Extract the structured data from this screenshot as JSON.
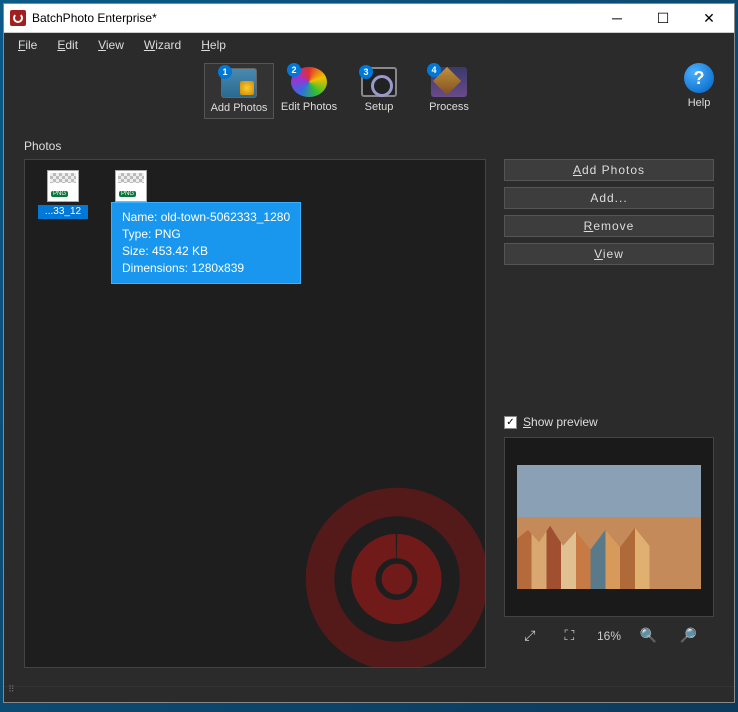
{
  "window": {
    "title": "BatchPhoto Enterprise*"
  },
  "menu": {
    "file": "File",
    "edit": "Edit",
    "view": "View",
    "wizard": "Wizard",
    "help": "Help"
  },
  "toolbar": {
    "add_photos": "Add Photos",
    "edit_photos": "Edit Photos",
    "setup": "Setup",
    "process": "Process",
    "help": "Help",
    "badges": {
      "add": "1",
      "edit": "2",
      "setup": "3",
      "process": "4"
    }
  },
  "section": {
    "photos": "Photos"
  },
  "thumbs": {
    "t0_label": "...33_12"
  },
  "tooltip": {
    "name_label": "Name: ",
    "name_value": "old-town-5062333_1280",
    "type_label": "Type: ",
    "type_value": "PNG",
    "size_label": "Size: ",
    "size_value": "453.42 KB",
    "dim_label": "Dimensions: ",
    "dim_value": "1280x839"
  },
  "buttons": {
    "add_photos": "Add Photos",
    "add": "Add...",
    "remove": "Remove",
    "view": "View"
  },
  "preview": {
    "show": "Show preview",
    "zoom_pct": "16%"
  }
}
